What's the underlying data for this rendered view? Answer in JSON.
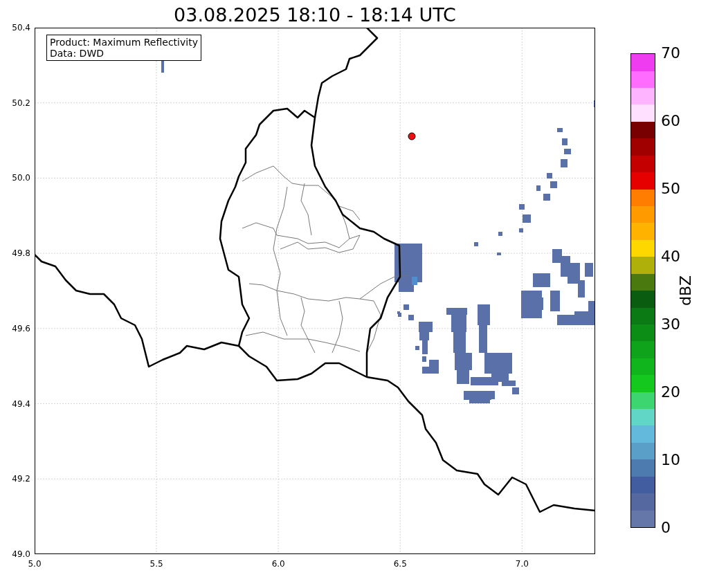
{
  "title": "03.08.2025 18:10 - 18:14 UTC",
  "info_box": [
    "Product: Maximum Reflectivity",
    "Data: DWD"
  ],
  "map": {
    "yticks": [
      "50.4",
      "50.2",
      "50.0",
      "49.8",
      "49.6",
      "49.4",
      "49.2",
      "49.0"
    ],
    "xticks": [
      "5.0",
      "5.5",
      "6.0",
      "6.5",
      "7.0"
    ],
    "marker": {
      "color": "#ee1111"
    }
  },
  "colorbar": {
    "label": "dBZ",
    "ticks": [
      "70",
      "60",
      "50",
      "40",
      "30",
      "20",
      "10",
      "0"
    ],
    "bands": [
      {
        "color": "#6477a8"
      },
      {
        "color": "#55689f"
      },
      {
        "color": "#435ea0"
      },
      {
        "color": "#4d7bb0"
      },
      {
        "color": "#5a9fc8"
      },
      {
        "color": "#63b9dc"
      },
      {
        "color": "#62d6c6"
      },
      {
        "color": "#3dd56f"
      },
      {
        "color": "#14c81e"
      },
      {
        "color": "#10b41c"
      },
      {
        "color": "#0fa31c"
      },
      {
        "color": "#0c8d16"
      },
      {
        "color": "#0b7a15"
      },
      {
        "color": "#0a5c10"
      },
      {
        "color": "#4a7a0f"
      },
      {
        "color": "#b0b00a"
      },
      {
        "color": "#ffd700"
      },
      {
        "color": "#ffb300"
      },
      {
        "color": "#ff9a00"
      },
      {
        "color": "#ff7d00"
      },
      {
        "color": "#e60000"
      },
      {
        "color": "#c40000"
      },
      {
        "color": "#a00000"
      },
      {
        "color": "#780000"
      },
      {
        "color": "#ffe0ff"
      },
      {
        "color": "#ffb4ff"
      },
      {
        "color": "#ff6cff"
      },
      {
        "color": "#f03cf0"
      }
    ]
  }
}
